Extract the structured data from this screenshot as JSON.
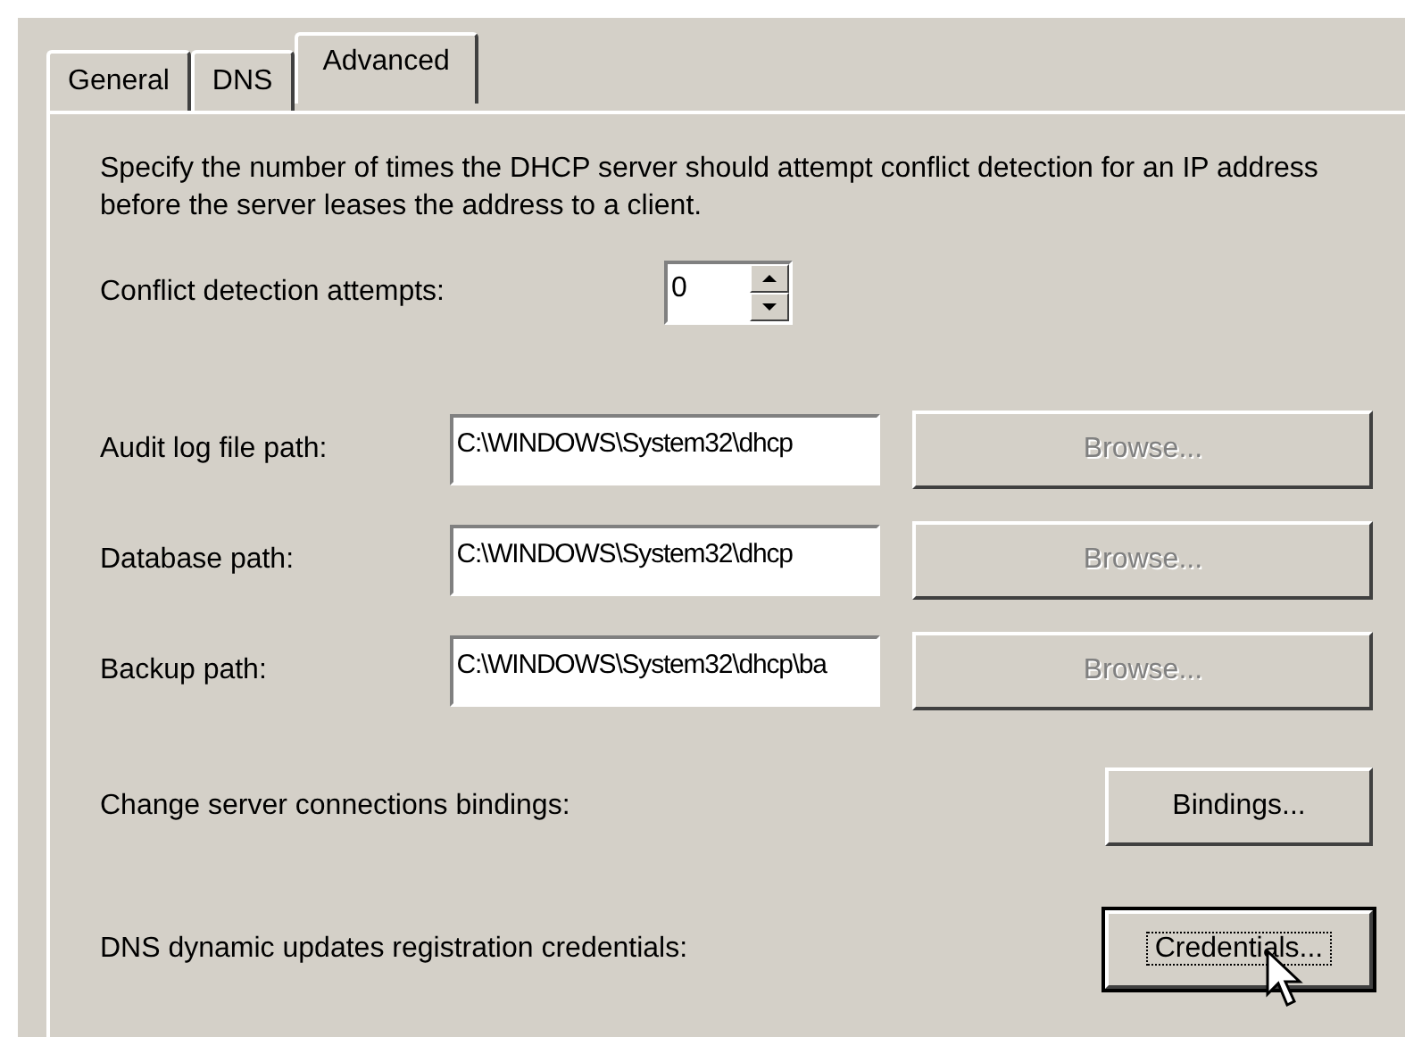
{
  "tabs": [
    {
      "label": "General",
      "selected": false
    },
    {
      "label": "DNS",
      "selected": false
    },
    {
      "label": "Advanced",
      "selected": true
    }
  ],
  "description": "Specify the number of times the DHCP server should attempt conflict detection for an IP address before the server leases the address to a client.",
  "conflict_detection": {
    "label": "Conflict detection attempts:",
    "value": "0"
  },
  "paths": [
    {
      "label": "Audit log file path:",
      "value": "C:\\WINDOWS\\System32\\dhcp",
      "button": "Browse...",
      "disabled": true
    },
    {
      "label": "Database path:",
      "value": "C:\\WINDOWS\\System32\\dhcp",
      "button": "Browse...",
      "disabled": true
    },
    {
      "label": "Backup path:",
      "value": "C:\\WINDOWS\\System32\\dhcp\\ba",
      "button": "Browse...",
      "disabled": true
    }
  ],
  "actions": [
    {
      "label": "Change server connections bindings:",
      "button": "Bindings...",
      "focused": false
    },
    {
      "label": "DNS dynamic updates registration credentials:",
      "button": "Credentials...",
      "focused": true
    }
  ]
}
